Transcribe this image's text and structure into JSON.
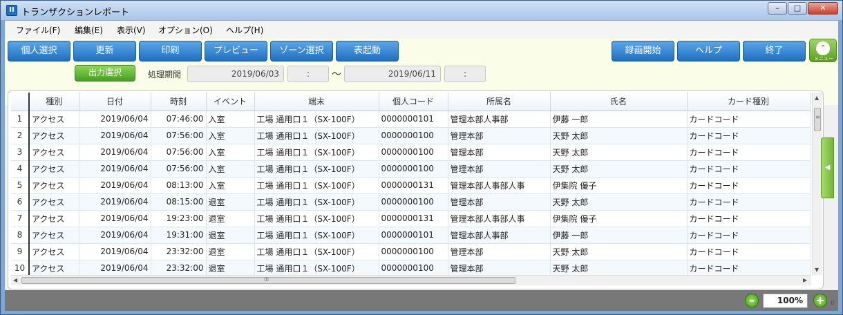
{
  "window": {
    "title": "トランザクションレポート",
    "icon_text": "II",
    "min": "–",
    "max": "□",
    "close": "✕"
  },
  "menu": [
    "ファイル(F)",
    "編集(E)",
    "表示(V)",
    "オプション(O)",
    "ヘルプ(H)"
  ],
  "toolbar": {
    "left_buttons": [
      "個人選択",
      "更新",
      "印刷",
      "プレビュー",
      "ゾーン選択",
      "表起動"
    ],
    "right_buttons": [
      "録画開始",
      "ヘルプ",
      "終了"
    ],
    "exit_icon": "⌃",
    "exit_caption": "メニュー",
    "output_select": "出力選択",
    "period_label": "処理期間",
    "date_from": "2019/06/03",
    "time_from": ":",
    "tilde": "〜",
    "date_to": "2019/06/11",
    "time_to": ":"
  },
  "table": {
    "columns": [
      "",
      "種別",
      "日付",
      "時刻",
      "イベント",
      "端末",
      "個人コード",
      "所属名",
      "氏名",
      "カード種別"
    ],
    "rows": [
      [
        "1",
        "アクセス",
        "2019/06/04",
        "07:46:00",
        "入室",
        "工場 通用口１（SX-100F）",
        "0000000101",
        "管理本部人事部",
        "伊藤 一郎",
        "カードコード"
      ],
      [
        "2",
        "アクセス",
        "2019/06/04",
        "07:56:00",
        "入室",
        "工場 通用口１（SX-100F）",
        "0000000100",
        "管理本部",
        "天野 太郎",
        "カードコード"
      ],
      [
        "3",
        "アクセス",
        "2019/06/04",
        "07:56:00",
        "入室",
        "工場 通用口１（SX-100F）",
        "0000000100",
        "管理本部",
        "天野 太郎",
        "カードコード"
      ],
      [
        "4",
        "アクセス",
        "2019/06/04",
        "07:56:00",
        "入室",
        "工場 通用口１（SX-100F）",
        "0000000100",
        "管理本部",
        "天野 太郎",
        "カードコード"
      ],
      [
        "5",
        "アクセス",
        "2019/06/04",
        "08:13:00",
        "入室",
        "工場 通用口１（SX-100F）",
        "0000000131",
        "管理本部人事部人事",
        "伊集院 優子",
        "カードコード"
      ],
      [
        "6",
        "アクセス",
        "2019/06/04",
        "08:15:00",
        "退室",
        "工場 通用口１（SX-100F）",
        "0000000100",
        "管理本部",
        "天野 太郎",
        "カードコード"
      ],
      [
        "7",
        "アクセス",
        "2019/06/04",
        "19:23:00",
        "退室",
        "工場 通用口１（SX-100F）",
        "0000000131",
        "管理本部人事部人事",
        "伊集院 優子",
        "カードコード"
      ],
      [
        "8",
        "アクセス",
        "2019/06/04",
        "19:31:00",
        "退室",
        "工場 通用口１（SX-100F）",
        "0000000101",
        "管理本部人事部",
        "伊藤 一郎",
        "カードコード"
      ],
      [
        "9",
        "アクセス",
        "2019/06/04",
        "23:32:00",
        "退室",
        "工場 通用口１（SX-100F）",
        "0000000100",
        "管理本部",
        "天野 太郎",
        "カードコード"
      ],
      [
        "10",
        "アクセス",
        "2019/06/04",
        "23:32:00",
        "退室",
        "工場 通用口１（SX-100F）",
        "0000000100",
        "管理本部",
        "天野 太郎",
        "カードコード"
      ]
    ]
  },
  "scroll": {
    "up": "▲",
    "down": "▼",
    "left": "◀",
    "right": "▶",
    "hgrip": "III",
    "vgrip": "≡"
  },
  "side_tab": "◀",
  "status": {
    "zoom_minus": "–",
    "zoom": "100%",
    "zoom_plus": "+",
    "grip": "⁞⁞"
  }
}
